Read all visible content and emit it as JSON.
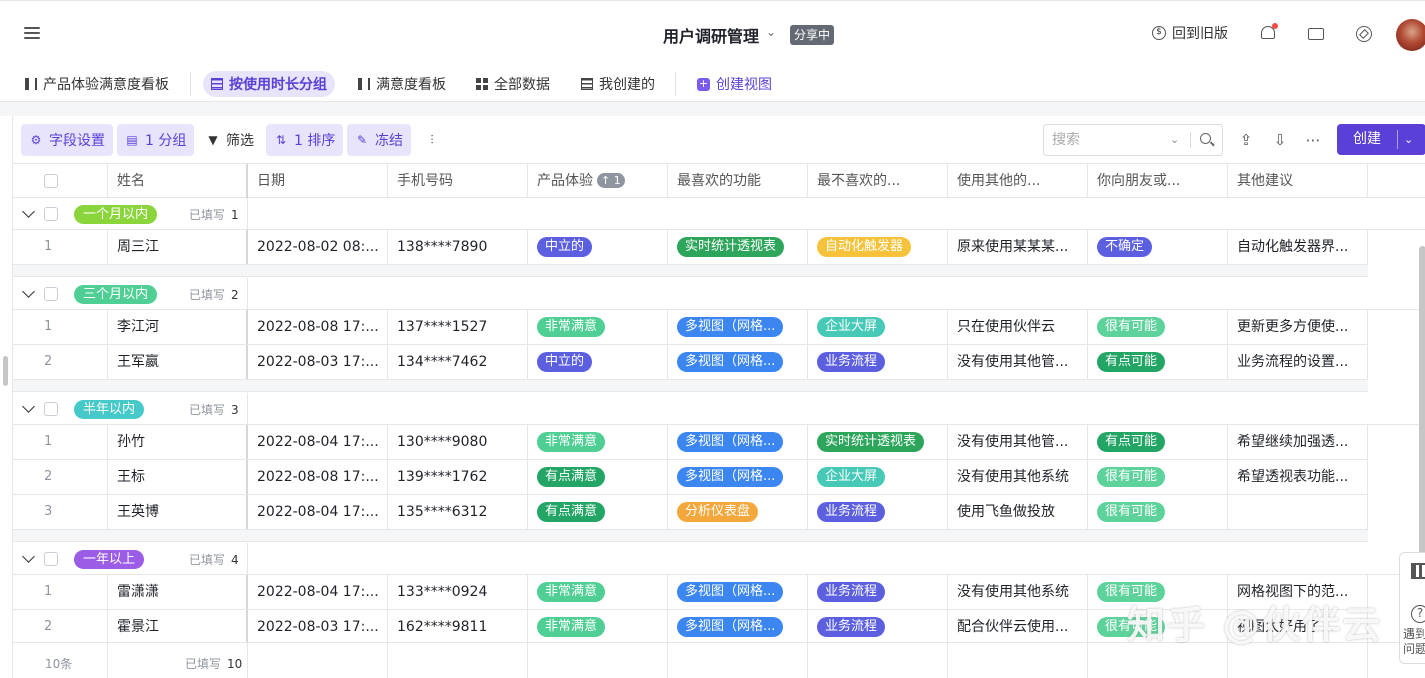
{
  "app": {
    "title": "用户调研管理",
    "share_badge": "分享中",
    "old_version": "回到旧版"
  },
  "views": [
    {
      "label": "产品体验满意度看板",
      "icon": "kanban-icon",
      "active": false
    },
    {
      "label": "按使用时长分组",
      "icon": "table-icon",
      "active": true
    },
    {
      "label": "满意度看板",
      "icon": "kanban-icon",
      "active": false
    },
    {
      "label": "全部数据",
      "icon": "grid-icon",
      "active": false
    },
    {
      "label": "我创建的",
      "icon": "table-icon",
      "active": false
    }
  ],
  "create_view": "创建视图",
  "toolbar": {
    "fields": "字段设置",
    "group": "1 分组",
    "filter": "筛选",
    "sort": "1 排序",
    "freeze": "冻结",
    "search_placeholder": "搜索",
    "create": "创建"
  },
  "columns": [
    "姓名",
    "日期",
    "手机号码",
    "产品体验",
    "最喜欢的功能",
    "最不喜欢的...",
    "使用其他的...",
    "你向朋友或...",
    "其他建议"
  ],
  "sort_badge": "↑ 1",
  "filled_label": "已填写",
  "colors": {
    "accent": "#5b3fd6",
    "中立的": "#5b5fe0",
    "非常满意": "#4fcf94",
    "有点满意": "#23a566",
    "实时统计透视表": "#2da65b",
    "多视图（网格...": "#3b86f0",
    "自动化触发器": "#f5c23a",
    "企业大屏": "#46c9b7",
    "业务流程": "#5b5fe0",
    "分析仪表盘": "#f4a73a",
    "不确定": "#5b5fe0",
    "很有可能": "#5dd39b",
    "有点可能": "#23a566",
    "一个月以内": "#8ad43c",
    "三个月以内": "#4fcf94",
    "半年以内": "#46c9c9",
    "一年以上": "#9b5ce6"
  },
  "groups": [
    {
      "label": "一个月以内",
      "filled": "1",
      "rows": [
        {
          "idx": "1",
          "name": "周三江",
          "date": "2022-08-02 08:...",
          "phone": "138****7890",
          "exp": "中立的",
          "fav": "实时统计透视表",
          "dislike": "自动化触发器",
          "other": "原来使用某某某...",
          "recommend": "不确定",
          "suggest": "自动化触发器界..."
        }
      ]
    },
    {
      "label": "三个月以内",
      "filled": "2",
      "rows": [
        {
          "idx": "1",
          "name": "李江河",
          "date": "2022-08-08 17:...",
          "phone": "137****1527",
          "exp": "非常满意",
          "fav": "多视图（网格...",
          "dislike": "企业大屏",
          "other": "只在使用伙伴云",
          "recommend": "很有可能",
          "suggest": "更新更多方便使..."
        },
        {
          "idx": "2",
          "name": "王军嬴",
          "date": "2022-08-03 17:...",
          "phone": "134****7462",
          "exp": "中立的",
          "fav": "多视图（网格...",
          "dislike": "业务流程",
          "other": "没有使用其他管...",
          "recommend": "有点可能",
          "suggest": "业务流程的设置..."
        }
      ]
    },
    {
      "label": "半年以内",
      "filled": "3",
      "rows": [
        {
          "idx": "1",
          "name": "孙竹",
          "date": "2022-08-04 17:...",
          "phone": "130****9080",
          "exp": "非常满意",
          "fav": "多视图（网格...",
          "dislike": "实时统计透视表",
          "other": "没有使用其他管...",
          "recommend": "有点可能",
          "suggest": "希望继续加强透..."
        },
        {
          "idx": "2",
          "name": "王标",
          "date": "2022-08-08 17:...",
          "phone": "139****1762",
          "exp": "有点满意",
          "fav": "多视图（网格...",
          "dislike": "企业大屏",
          "other": "没有使用其他系统",
          "recommend": "很有可能",
          "suggest": "希望透视表功能..."
        },
        {
          "idx": "3",
          "name": "王英博",
          "date": "2022-08-04 17:...",
          "phone": "135****6312",
          "exp": "有点满意",
          "fav": "分析仪表盘",
          "dislike": "业务流程",
          "other": "使用飞鱼做投放",
          "recommend": "很有可能",
          "suggest": ""
        }
      ]
    },
    {
      "label": "一年以上",
      "filled": "4",
      "rows": [
        {
          "idx": "1",
          "name": "雷潇潇",
          "date": "2022-08-04 17:...",
          "phone": "133****0924",
          "exp": "非常满意",
          "fav": "多视图（网格...",
          "dislike": "业务流程",
          "other": "没有使用其他系统",
          "recommend": "很有可能",
          "suggest": "网格视图下的范..."
        },
        {
          "idx": "2",
          "name": "霍景江",
          "date": "2022-08-03 17:...",
          "phone": "162****9811",
          "exp": "非常满意",
          "fav": "多视图（网格...",
          "dislike": "业务流程",
          "other": "配合伙伴云使用...",
          "recommend": "很有可能",
          "suggest": "视图太好用了..."
        }
      ]
    }
  ],
  "footer": {
    "count": "10条",
    "filled": "10"
  },
  "side_panel": {
    "text": "遇到问题"
  },
  "watermark": "知乎 @伙伴云"
}
